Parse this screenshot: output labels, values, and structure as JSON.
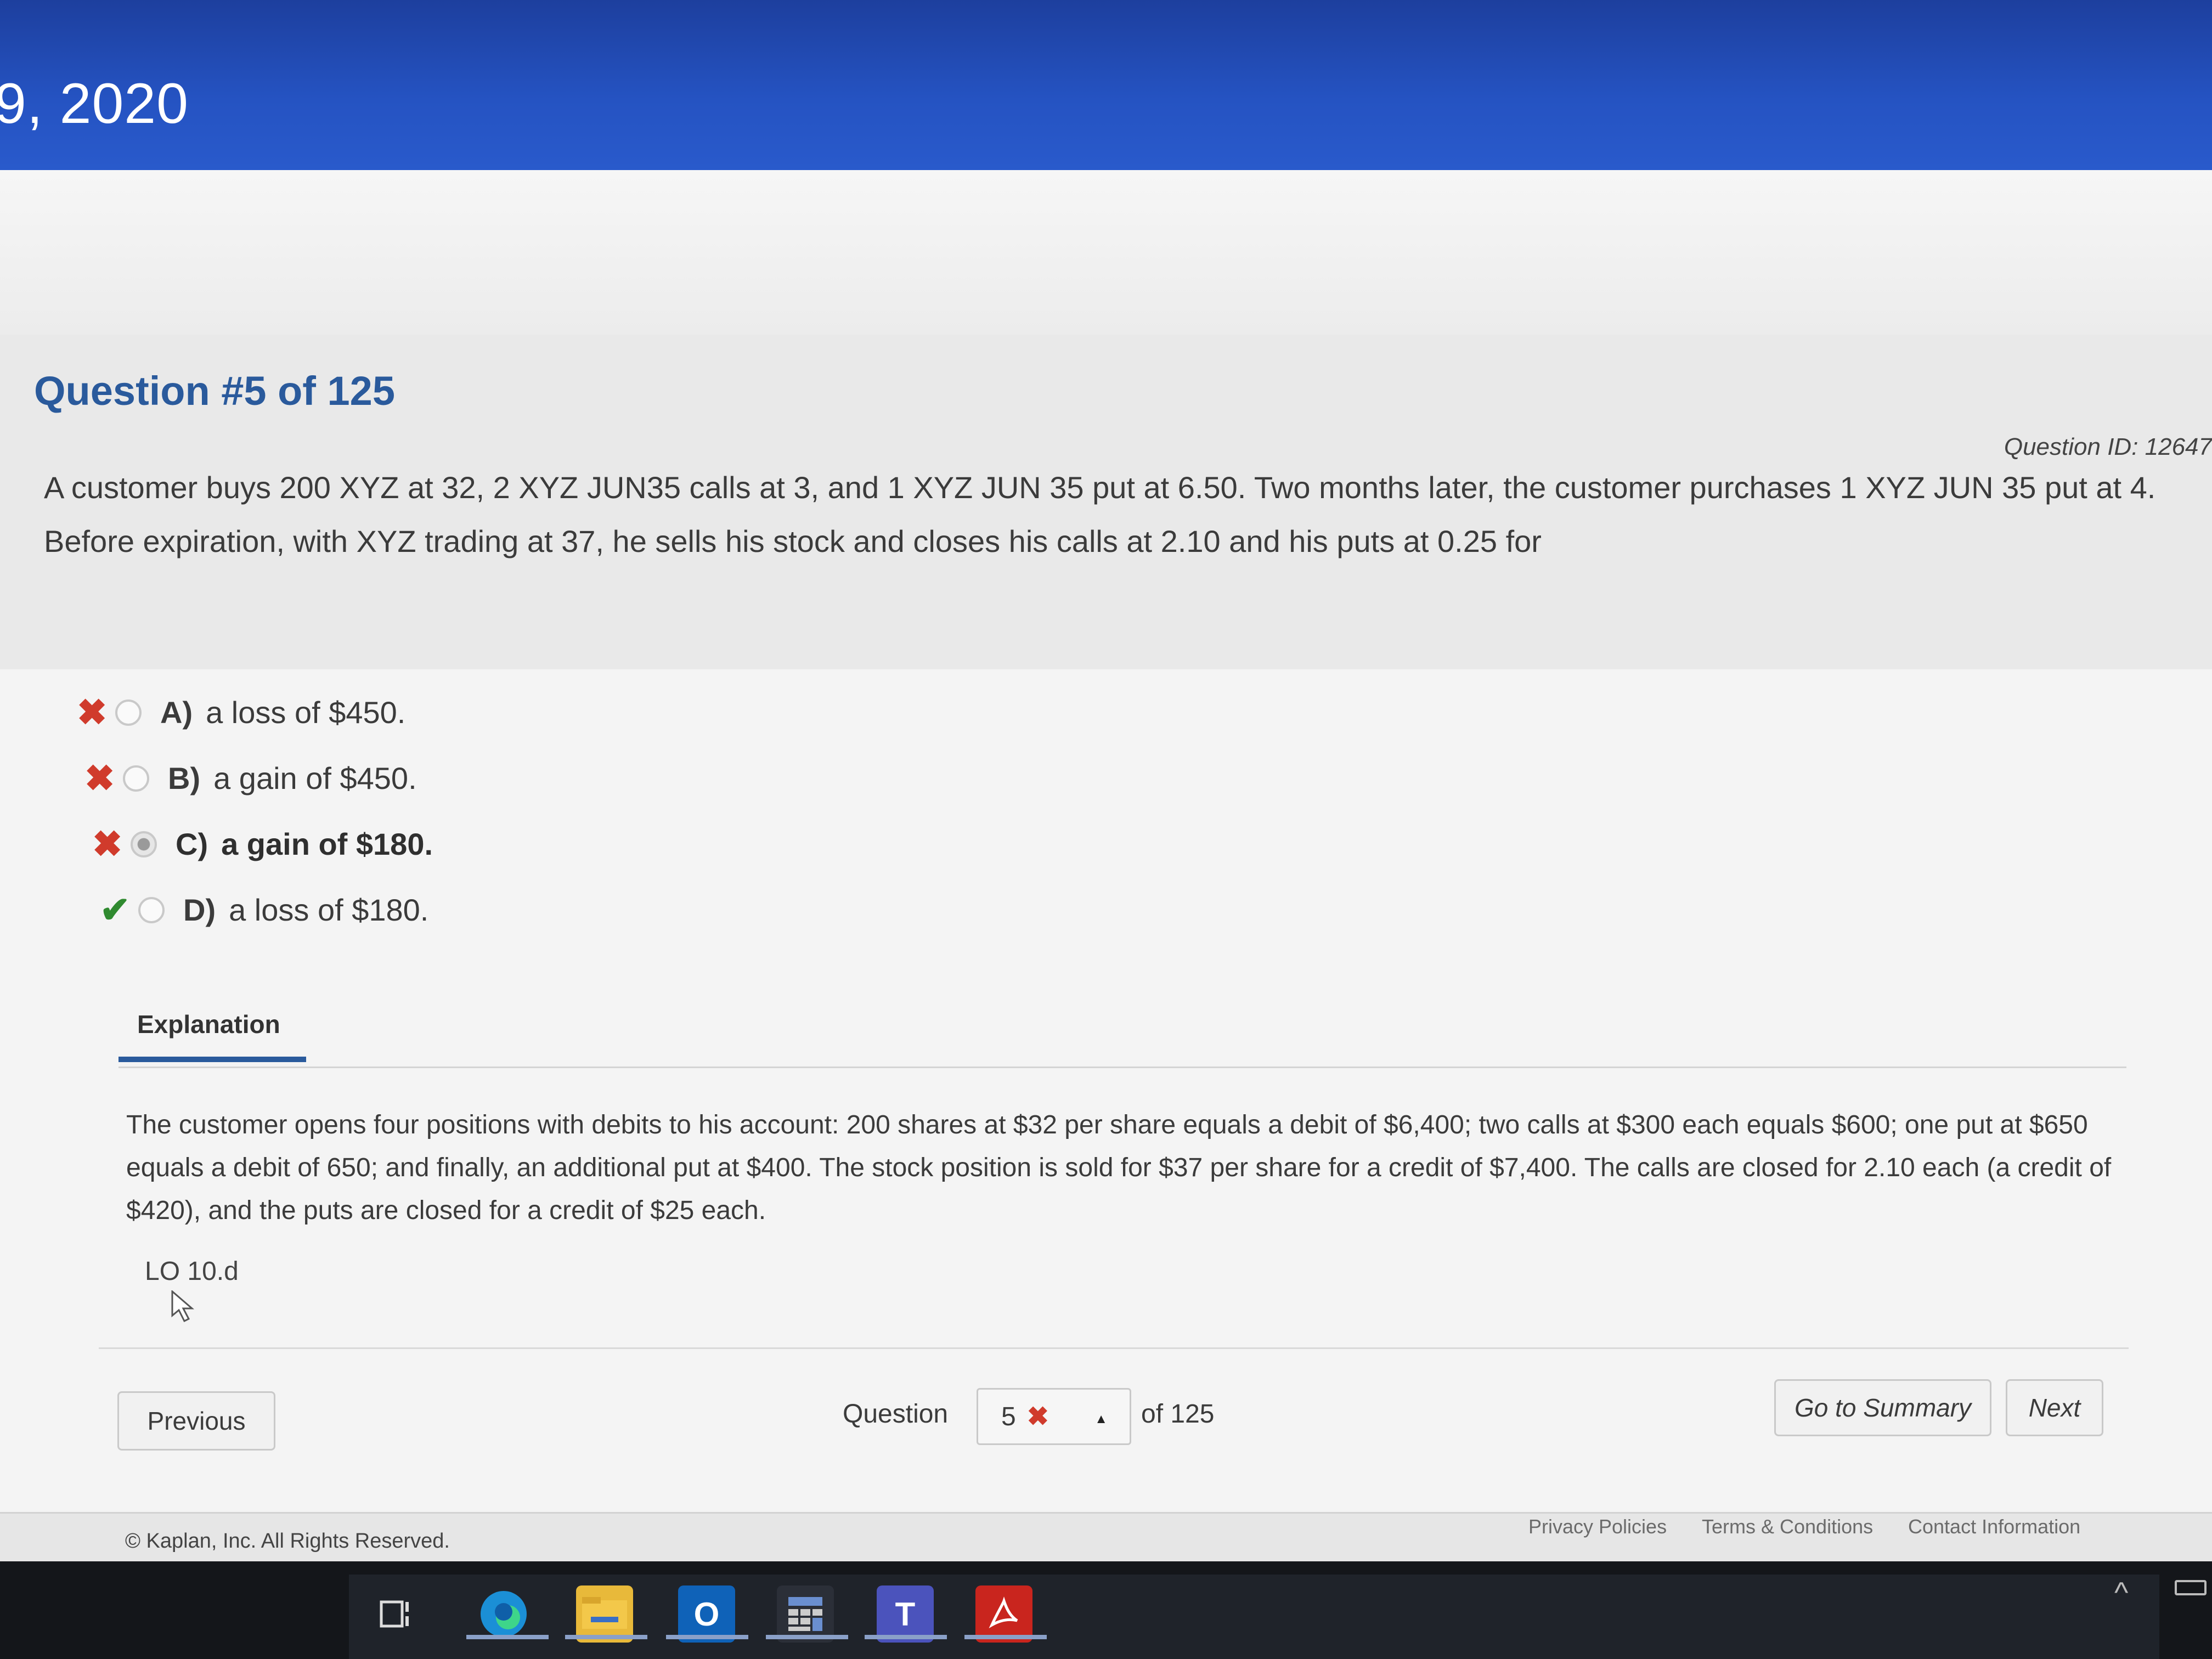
{
  "banner": {
    "date": "9, 2020"
  },
  "question": {
    "title": "Question #5 of 125",
    "id_label": "Question ID: 12647",
    "text": "A customer buys 200 XYZ at 32, 2 XYZ JUN35 calls at 3, and 1 XYZ JUN 35 put at 6.50. Two months later, the customer purchases 1 XYZ JUN 35 put at 4. Before expiration, with XYZ trading at 37, he sells his stock and closes his calls at 2.10 and his puts at 0.25 for"
  },
  "answers": [
    {
      "letter": "A)",
      "text": "a loss of $450.",
      "result": "wrong",
      "selected": false,
      "mark": "✖"
    },
    {
      "letter": "B)",
      "text": "a gain of $450.",
      "result": "wrong",
      "selected": false,
      "mark": "✖"
    },
    {
      "letter": "C)",
      "text": "a gain of $180.",
      "result": "wrong",
      "selected": true,
      "mark": "✖"
    },
    {
      "letter": "D)",
      "text": "a loss of $180.",
      "result": "correct",
      "selected": false,
      "mark": "✔"
    }
  ],
  "explanation": {
    "tab_label": "Explanation",
    "text": "The customer opens four positions with debits to his account: 200 shares at $32 per share equals a debit of $6,400; two calls at $300 each equals $600; one put at $650 equals a debit of 650; and finally, an additional put at $400. The stock position is sold for $37 per share for a credit of $7,400. The calls are closed for 2.10 each (a credit of $420), and the puts are closed for a credit of $25 each.",
    "lo_code": "LO 10.d"
  },
  "nav": {
    "previous_label": "Previous",
    "question_label": "Question",
    "current_question": "5",
    "current_mark": "✖",
    "total_label": "of 125",
    "summary_label": "Go to Summary",
    "next_label": "Next"
  },
  "footer": {
    "copyright": "© Kaplan, Inc. All Rights Reserved.",
    "links": [
      "Privacy Policies",
      "Terms & Conditions",
      "Contact Information"
    ]
  },
  "taskbar": {
    "icons": [
      "task-view-icon",
      "edge-icon",
      "file-explorer-icon",
      "outlook-icon",
      "calculator-icon",
      "teams-icon",
      "acrobat-icon"
    ]
  },
  "colors": {
    "banner_blue": "#2553c2",
    "title_blue": "#2a5a9c",
    "wrong_red": "#d03b2c",
    "correct_green": "#2f8a2f"
  }
}
